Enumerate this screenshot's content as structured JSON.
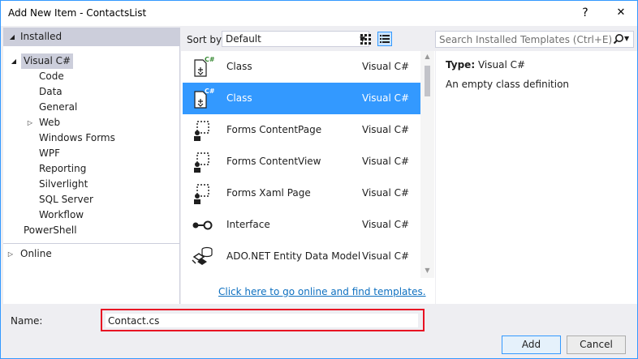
{
  "window": {
    "title": "Add New Item - ContactsList",
    "help": "?",
    "close": "✕"
  },
  "tree": {
    "installed": "Installed",
    "items": [
      {
        "label": "Visual C#"
      },
      {
        "label": "Code"
      },
      {
        "label": "Data"
      },
      {
        "label": "General"
      },
      {
        "label": "Web"
      },
      {
        "label": "Windows Forms"
      },
      {
        "label": "WPF"
      },
      {
        "label": "Reporting"
      },
      {
        "label": "Silverlight"
      },
      {
        "label": "SQL Server"
      },
      {
        "label": "Workflow"
      },
      {
        "label": "PowerShell"
      }
    ],
    "online": "Online"
  },
  "sort": {
    "label": "Sort by:",
    "value": "Default"
  },
  "search": {
    "placeholder": "Search Installed Templates (Ctrl+E)"
  },
  "templates": [
    {
      "name": "Class",
      "lang": "Visual C#",
      "icon": "class-icon"
    },
    {
      "name": "Class",
      "lang": "Visual C#",
      "icon": "class-icon"
    },
    {
      "name": "Forms ContentPage",
      "lang": "Visual C#",
      "icon": "forms-page-icon"
    },
    {
      "name": "Forms ContentView",
      "lang": "Visual C#",
      "icon": "forms-page-icon"
    },
    {
      "name": "Forms Xaml Page",
      "lang": "Visual C#",
      "icon": "forms-page-icon"
    },
    {
      "name": "Interface",
      "lang": "Visual C#",
      "icon": "interface-icon"
    },
    {
      "name": "ADO.NET Entity Data Model",
      "lang": "Visual C#",
      "icon": "entity-model-icon"
    }
  ],
  "online_link": "Click here to go online and find templates.",
  "details": {
    "type_label": "Type:",
    "type_value": "Visual C#",
    "description": "An empty class definition"
  },
  "name_field": {
    "label": "Name:",
    "value": "Contact.cs"
  },
  "buttons": {
    "add": "Add",
    "cancel": "Cancel"
  },
  "colors": {
    "accent": "#3399ff",
    "highlight": "#e81123",
    "link": "#0e70c0"
  }
}
